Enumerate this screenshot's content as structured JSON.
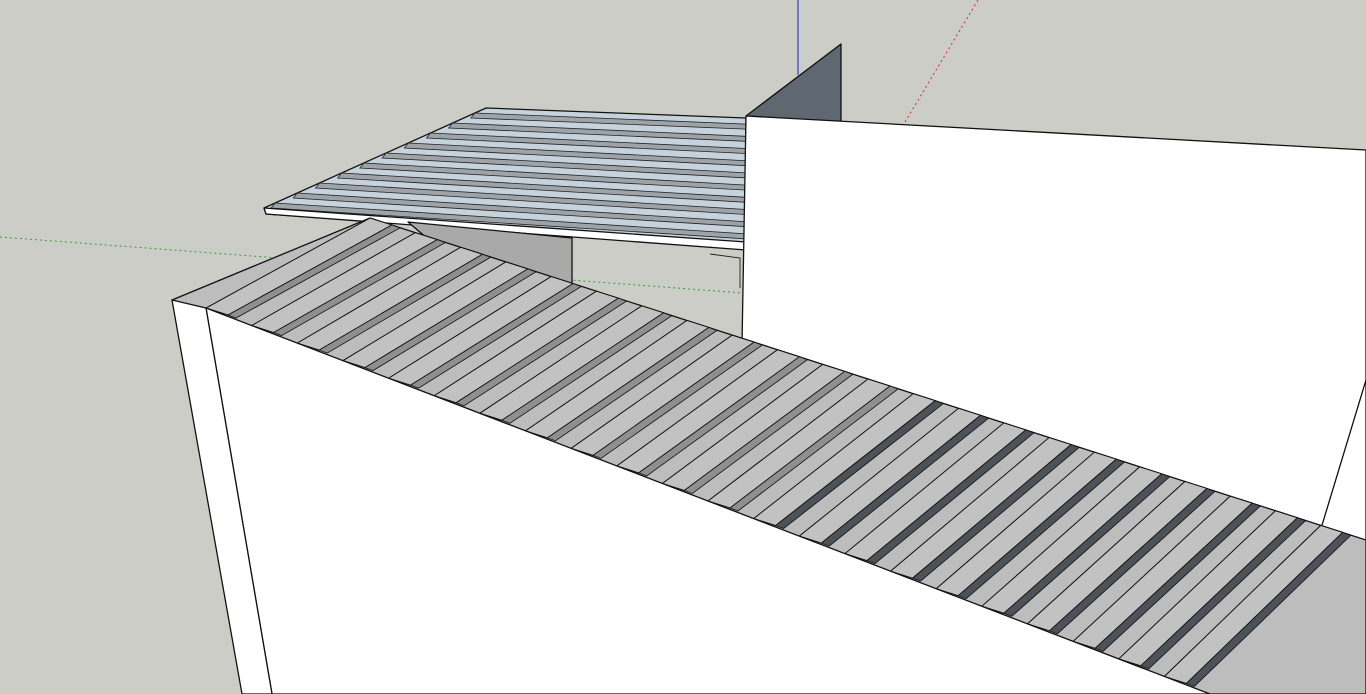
{
  "app": {
    "view": "3d-model-viewport"
  },
  "colors": {
    "background": "#cdcdc8",
    "face_white": "#ffffff",
    "face_light_gray": "#bdbdbd",
    "face_mid_gray": "#a9a9a9",
    "face_dark": "#5f6770",
    "roof_blue": "#c6d3dd",
    "axis_red": "#d03030",
    "axis_green": "#30a030",
    "axis_blue": "#3040d0",
    "edge": "#111111"
  },
  "axes": {
    "red": "red-axis",
    "green": "green-axis",
    "blue": "blue-axis"
  },
  "model": {
    "upper_roof_ribs": 10,
    "lower_roof_ribs": 22
  }
}
